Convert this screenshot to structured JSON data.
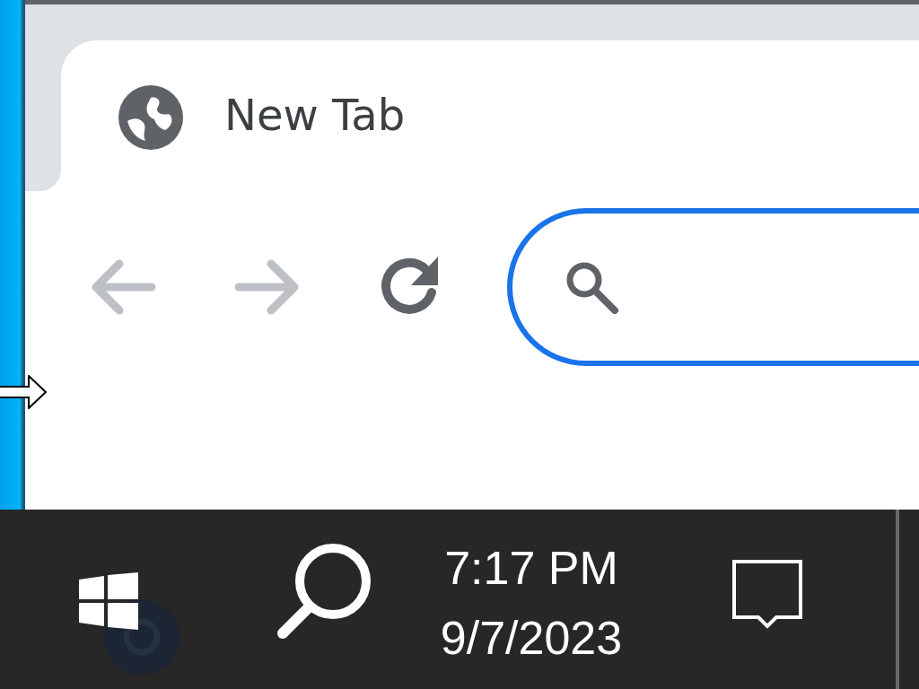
{
  "tab": {
    "title": "New Tab",
    "selected": true
  },
  "toolbar": {
    "back": {
      "disabled": true
    },
    "forward": {
      "disabled": true
    },
    "omnibox": {
      "focused": true
    }
  },
  "taskbar": {
    "time": "7:17 PM",
    "date": "9/7/2023"
  }
}
